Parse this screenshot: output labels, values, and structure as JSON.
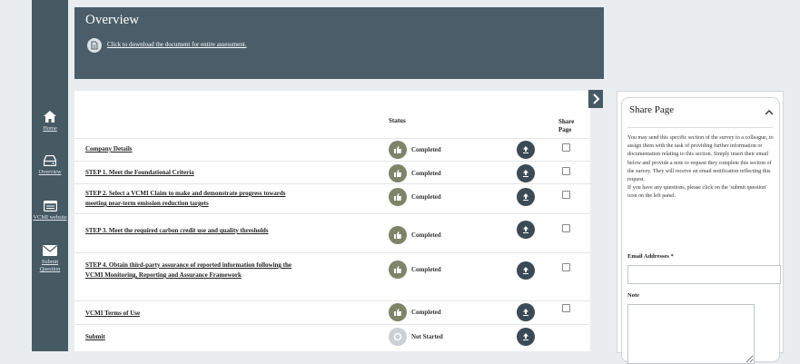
{
  "sidebar": {
    "items": [
      {
        "label": "Home",
        "icon": "home-icon"
      },
      {
        "label": "Overview",
        "icon": "drive-icon"
      },
      {
        "label": "VCMI website",
        "icon": "website-icon"
      },
      {
        "label": "Submit Question",
        "icon": "envelope-icon"
      }
    ]
  },
  "overview": {
    "title": "Overview",
    "download_link": "Click to download the document for entire assessment."
  },
  "table": {
    "headers": {
      "status": "Status",
      "share": "Share Page"
    },
    "rows": [
      {
        "task": "Company Details",
        "status": "Completed"
      },
      {
        "task": "STEP 1. Meet the Foundational Criteria",
        "status": "Completed"
      },
      {
        "task": "STEP 2. Select a VCMI Claim to make and demonstrate progress towards meeting near-term emission reduction targets",
        "status": "Completed"
      },
      {
        "task": "STEP 3. Meet the required carbon credit use and quality thresholds",
        "status": "Completed"
      },
      {
        "task": "STEP 4. Obtain third-party assurance of reported information following the VCMI Monitoring, Reporting and Assurance Framework",
        "status": "Completed"
      },
      {
        "task": "VCMI Terms of Use",
        "status": "Completed"
      },
      {
        "task": "Submit",
        "status": "Not Started"
      }
    ]
  },
  "share_panel": {
    "title": "Share Page",
    "description": "You may send this specific section of the survey to a colleague, to assign them with the task of providing further information or documentation relating to this section. Simply insert their email below and provide a note to request they complete this section of the survey. They will receive an email notification reflecting this request.\nIf you have any questions, please click on the 'submit question' icon on the left panel.",
    "email_label": "Email Addresses *",
    "email_value": "",
    "note_label": "Note",
    "note_value": ""
  },
  "colors": {
    "sidebar": "#465a64",
    "header": "#4b5d68",
    "completed": "#7d8468",
    "not_started": "#cdd0d3",
    "download_button": "#3b4a55"
  }
}
